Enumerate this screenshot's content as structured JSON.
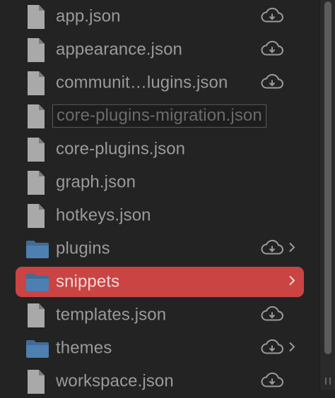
{
  "files": [
    {
      "type": "file",
      "name": "app.json",
      "cloud": true,
      "chevron": false,
      "state": "normal"
    },
    {
      "type": "file",
      "name": "appearance.json",
      "cloud": true,
      "chevron": false,
      "state": "normal"
    },
    {
      "type": "file",
      "name": "communit…lugins.json",
      "cloud": true,
      "chevron": false,
      "state": "normal"
    },
    {
      "type": "file",
      "name": "core-plugins-migration.json",
      "cloud": false,
      "chevron": false,
      "state": "renaming"
    },
    {
      "type": "file",
      "name": "core-plugins.json",
      "cloud": false,
      "chevron": false,
      "state": "normal"
    },
    {
      "type": "file",
      "name": "graph.json",
      "cloud": false,
      "chevron": false,
      "state": "normal"
    },
    {
      "type": "file",
      "name": "hotkeys.json",
      "cloud": false,
      "chevron": false,
      "state": "normal"
    },
    {
      "type": "folder",
      "name": "plugins",
      "cloud": true,
      "chevron": true,
      "state": "normal"
    },
    {
      "type": "folder",
      "name": "snippets",
      "cloud": false,
      "chevron": true,
      "state": "selected"
    },
    {
      "type": "file",
      "name": "templates.json",
      "cloud": true,
      "chevron": false,
      "state": "normal"
    },
    {
      "type": "folder",
      "name": "themes",
      "cloud": true,
      "chevron": true,
      "state": "normal"
    },
    {
      "type": "file",
      "name": "workspace.json",
      "cloud": true,
      "chevron": false,
      "state": "normal"
    }
  ],
  "colors": {
    "background": "#232323",
    "text": "#9a9a9a",
    "selection": "#c94443",
    "folder": "#4d7fb0",
    "file_icon": "#a9a9a9"
  }
}
